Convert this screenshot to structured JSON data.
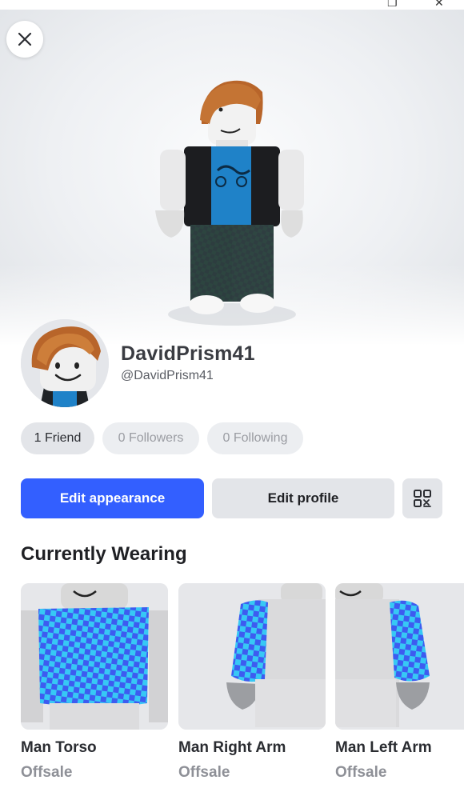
{
  "profile": {
    "display_name": "DavidPrism41",
    "username": "@DavidPrism41"
  },
  "stats": {
    "friends": "1 Friend",
    "followers": "0 Followers",
    "following": "0 Following"
  },
  "actions": {
    "edit_appearance": "Edit appearance",
    "edit_profile": "Edit profile"
  },
  "wearing": {
    "title": "Currently Wearing",
    "items": [
      {
        "name": "Man Torso",
        "status": "Offsale"
      },
      {
        "name": "Man Right Arm",
        "status": "Offsale"
      },
      {
        "name": "Man Left Arm",
        "status": "Offsale"
      }
    ]
  },
  "colors": {
    "primary": "#335fff",
    "pill": "#eceef1",
    "checker_a": "#3d5cf0",
    "checker_b": "#37c8f5"
  },
  "icons": {
    "close": "close-icon",
    "qr": "qr-code-icon"
  }
}
